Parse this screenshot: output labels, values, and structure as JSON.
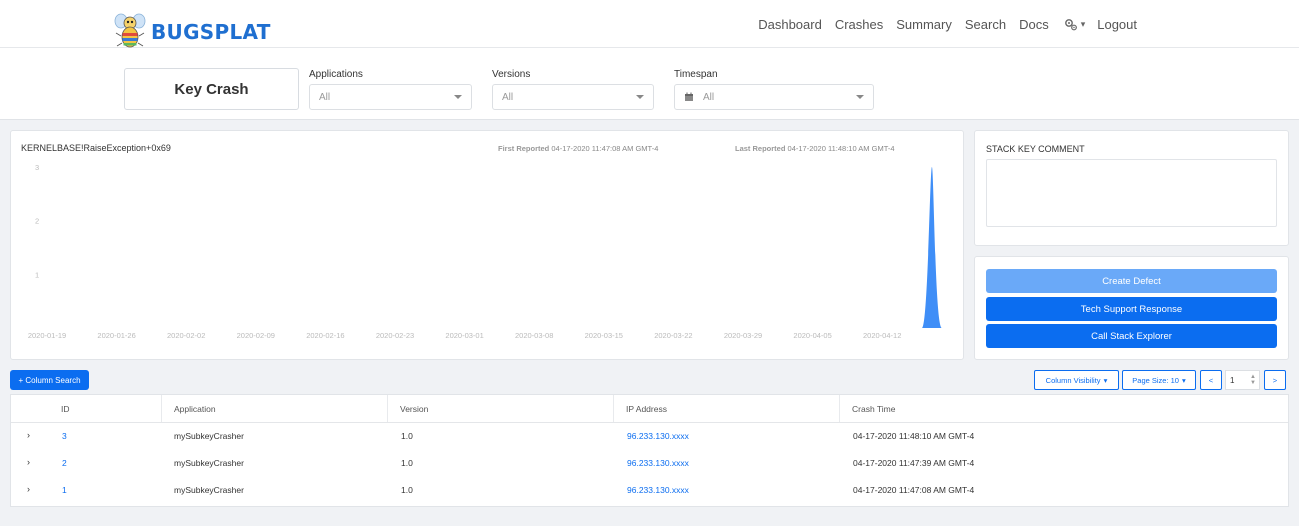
{
  "brand": {
    "name": "BUGSPLAT"
  },
  "nav": {
    "items": [
      "Dashboard",
      "Crashes",
      "Summary",
      "Search",
      "Docs"
    ],
    "settings_icon": "gears-icon",
    "logout": "Logout"
  },
  "filters": {
    "title": "Key Crash",
    "applications": {
      "label": "Applications",
      "value": "All"
    },
    "versions": {
      "label": "Versions",
      "value": "All"
    },
    "timespan": {
      "label": "Timespan",
      "value": "All",
      "icon": "calendar-icon"
    }
  },
  "chart_card": {
    "stack_key": "KERNELBASE!RaiseException+0x69",
    "first_reported_label": "First Reported",
    "first_reported_value": "04-17-2020 11:47:08 AM GMT-4",
    "last_reported_label": "Last Reported",
    "last_reported_value": "04-17-2020 11:48:10 AM GMT-4"
  },
  "chart_data": {
    "type": "area",
    "x": [
      "2020-01-19",
      "2020-01-26",
      "2020-02-02",
      "2020-02-09",
      "2020-02-16",
      "2020-02-23",
      "2020-03-01",
      "2020-03-08",
      "2020-03-15",
      "2020-03-22",
      "2020-03-29",
      "2020-04-05",
      "2020-04-12",
      "2020-04-17"
    ],
    "xticks": [
      "2020-01-19",
      "2020-01-26",
      "2020-02-02",
      "2020-02-09",
      "2020-02-16",
      "2020-02-23",
      "2020-03-01",
      "2020-03-08",
      "2020-03-15",
      "2020-03-22",
      "2020-03-29",
      "2020-04-05",
      "2020-04-12"
    ],
    "values": [
      0,
      0,
      0,
      0,
      0,
      0,
      0,
      0,
      0,
      0,
      0,
      0,
      0,
      3
    ],
    "yticks": [
      1,
      2,
      3
    ],
    "ylim": [
      0,
      3
    ],
    "color": "#3f8ef7",
    "grid": false,
    "title": "",
    "xlabel": "",
    "ylabel": ""
  },
  "comment": {
    "title": "STACK KEY COMMENT",
    "value": ""
  },
  "actions": {
    "create_defect": "Create Defect",
    "tech_support": "Tech Support Response",
    "call_stack": "Call Stack Explorer"
  },
  "table_controls": {
    "column_search": "+ Column Search",
    "column_visibility": "Column Visibility",
    "page_size": "Page Size: 10",
    "prev": "<",
    "next": ">",
    "page": "1"
  },
  "table": {
    "columns": [
      "ID",
      "Application",
      "Version",
      "IP Address",
      "Crash Time"
    ],
    "rows": [
      {
        "id": "3",
        "application": "mySubkeyCrasher",
        "version": "1.0",
        "ip": "96.233.130.xxxx",
        "time": "04-17-2020 11:48:10 AM GMT-4"
      },
      {
        "id": "2",
        "application": "mySubkeyCrasher",
        "version": "1.0",
        "ip": "96.233.130.xxxx",
        "time": "04-17-2020 11:47:39 AM GMT-4"
      },
      {
        "id": "1",
        "application": "mySubkeyCrasher",
        "version": "1.0",
        "ip": "96.233.130.xxxx",
        "time": "04-17-2020 11:47:08 AM GMT-4"
      }
    ]
  },
  "colors": {
    "primary": "#0b6df0",
    "disabled": "#6aa9f8",
    "brand": "#1f6fd0"
  }
}
